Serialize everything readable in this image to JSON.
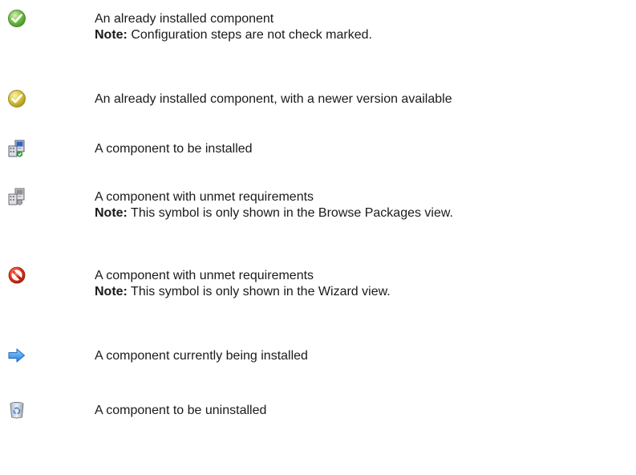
{
  "legend": {
    "items": [
      {
        "icon": "green-checkmark-icon",
        "text": "An already installed component",
        "note_label": "Note:",
        "note_text": " Configuration steps are not check marked."
      },
      {
        "icon": "yellow-checkmark-icon",
        "text": "An already installed component, with a newer version available"
      },
      {
        "icon": "install-package-color-icon",
        "text": "A component to be installed"
      },
      {
        "icon": "install-package-gray-icon",
        "text": "A component with unmet requirements",
        "note_label": "Note:",
        "note_text": " This symbol is only shown in the Browse Packages view."
      },
      {
        "icon": "prohibited-icon",
        "text": "A component with unmet requirements",
        "note_label": "Note:",
        "note_text": " This symbol is only shown in the Wizard view."
      },
      {
        "icon": "blue-arrow-right-icon",
        "text": "A component currently being installed"
      },
      {
        "icon": "recycle-bin-icon",
        "text": "A component to be uninstalled"
      }
    ]
  }
}
